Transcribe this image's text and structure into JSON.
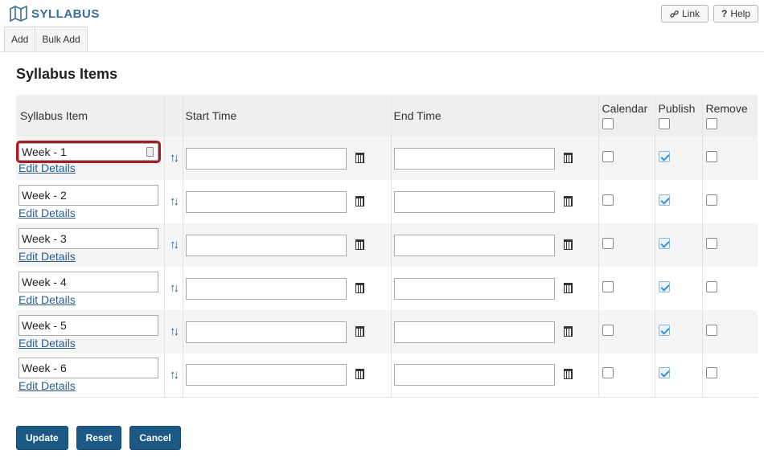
{
  "header": {
    "title": "SYLLABUS",
    "title_icon": "map-icon",
    "link_label": "Link",
    "help_label": "Help",
    "tabs": [
      "Add",
      "Bulk Add"
    ]
  },
  "page_title": "Syllabus Items",
  "table": {
    "headers": {
      "item": "Syllabus Item",
      "start": "Start Time",
      "end": "End Time",
      "calendar": "Calendar",
      "publish": "Publish",
      "remove": "Remove"
    },
    "edit_label": "Edit Details",
    "rows": [
      {
        "title": "Week - 1",
        "start": "",
        "end": "",
        "calendar": false,
        "publish": true,
        "remove": false
      },
      {
        "title": "Week - 2",
        "start": "",
        "end": "",
        "calendar": false,
        "publish": true,
        "remove": false
      },
      {
        "title": "Week - 3",
        "start": "",
        "end": "",
        "calendar": false,
        "publish": true,
        "remove": false
      },
      {
        "title": "Week - 4",
        "start": "",
        "end": "",
        "calendar": false,
        "publish": true,
        "remove": false
      },
      {
        "title": "Week - 5",
        "start": "",
        "end": "",
        "calendar": false,
        "publish": true,
        "remove": false
      },
      {
        "title": "Week - 6",
        "start": "",
        "end": "",
        "calendar": false,
        "publish": true,
        "remove": false
      }
    ]
  },
  "buttons": {
    "update": "Update",
    "reset": "Reset",
    "cancel": "Cancel"
  },
  "colors": {
    "brand": "#3a6e96",
    "primary_button": "#1c5a85",
    "focus_outline": "#a41f24"
  }
}
